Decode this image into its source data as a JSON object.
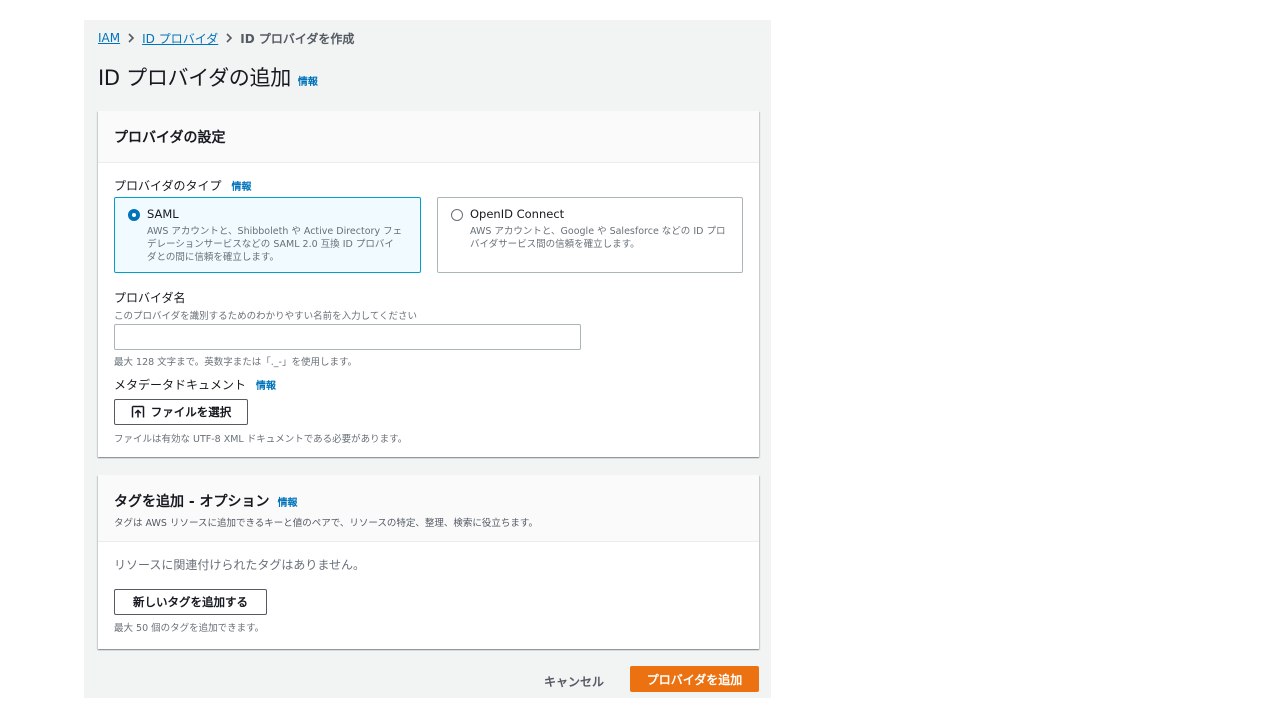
{
  "breadcrumb": {
    "items": [
      {
        "label": "IAM"
      },
      {
        "label": "ID プロバイダ"
      }
    ],
    "current": "ID プロバイダを作成"
  },
  "page": {
    "title": "ID プロバイダの追加",
    "info": "情報"
  },
  "settings": {
    "title": "プロバイダの設定",
    "provider_type": {
      "label": "プロバイダのタイプ",
      "info": "情報",
      "options": [
        {
          "title": "SAML",
          "description_lines": [
            "AWS アカウントと、Shibboleth や Active Directory フェ",
            "デレーションサービスなどの SAML 2.0 互換 ID プロバイ",
            "ダとの間に信頼を確立します。"
          ],
          "selected": true
        },
        {
          "title": "OpenID Connect",
          "description_lines": [
            "AWS アカウントと、Google や Salesforce などの ID プロ",
            "バイダサービス間の信頼を確立します。"
          ],
          "selected": false
        }
      ]
    },
    "provider_name": {
      "label": "プロバイダ名",
      "description": "このプロバイダを識別するためのわかりやすい名前を入力してください",
      "value": "",
      "constraint": "最大 128 文字まで。英数字または「._-」を使用します。"
    },
    "metadata": {
      "label": "メタデータドキュメント",
      "info": "情報",
      "button_label": "ファイルを選択",
      "constraint": "ファイルは有効な UTF-8 XML ドキュメントである必要があります。"
    }
  },
  "tags": {
    "title": "タグを追加 - オプション",
    "info": "情報",
    "description": "タグは AWS リソースに追加できるキーと値のペアで、リソースの特定、整理、検索に役立ちます。",
    "empty_text": "リソースに関連付けられたタグはありません。",
    "add_button": "新しいタグを追加する",
    "constraint": "最大 50 個のタグを追加できます。"
  },
  "footer": {
    "cancel": "キャンセル",
    "submit": "プロバイダを追加"
  },
  "colors": {
    "link": "#0073bb",
    "primary": "#ec7211",
    "selected_border": "#00a1c9",
    "selected_bg": "#f1faff",
    "background": "#f2f3f3"
  }
}
